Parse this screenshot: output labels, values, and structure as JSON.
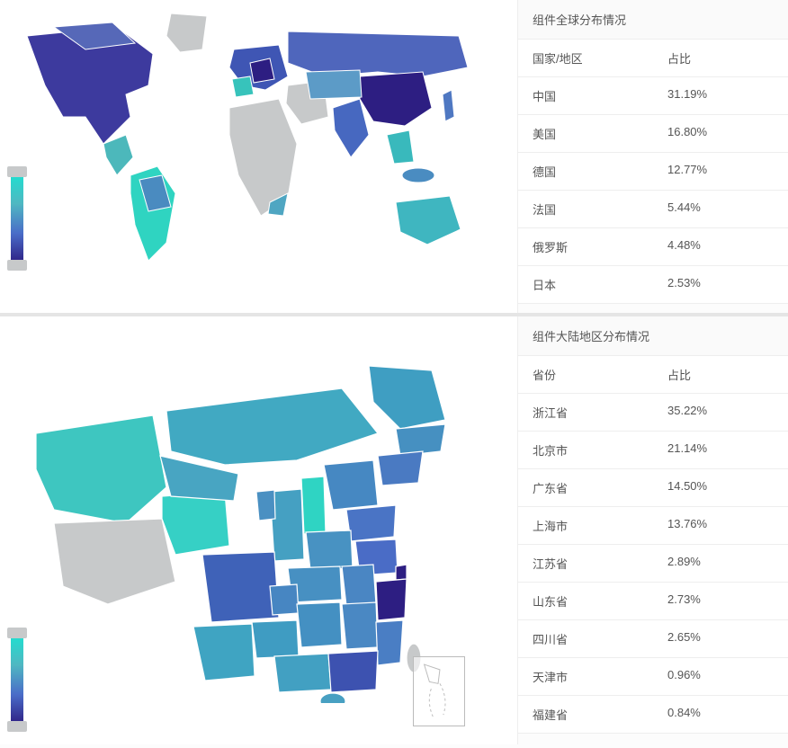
{
  "global": {
    "title": "组件全球分布情况",
    "col1": "国家/地区",
    "col2": "占比",
    "rows": [
      {
        "name": "中国",
        "pct": "31.19%"
      },
      {
        "name": "美国",
        "pct": "16.80%"
      },
      {
        "name": "德国",
        "pct": "12.77%"
      },
      {
        "name": "法国",
        "pct": "5.44%"
      },
      {
        "name": "俄罗斯",
        "pct": "4.48%"
      },
      {
        "name": "日本",
        "pct": "2.53%"
      }
    ]
  },
  "chinaMap": {
    "title": "组件大陆地区分布情况",
    "col1": "省份",
    "col2": "占比",
    "rows": [
      {
        "name": "浙江省",
        "pct": "35.22%"
      },
      {
        "name": "北京市",
        "pct": "21.14%"
      },
      {
        "name": "广东省",
        "pct": "14.50%"
      },
      {
        "name": "上海市",
        "pct": "13.76%"
      },
      {
        "name": "江苏省",
        "pct": "2.89%"
      },
      {
        "name": "山东省",
        "pct": "2.73%"
      },
      {
        "name": "四川省",
        "pct": "2.65%"
      },
      {
        "name": "天津市",
        "pct": "0.96%"
      },
      {
        "name": "福建省",
        "pct": "0.84%"
      }
    ]
  },
  "chart_data": [
    {
      "type": "choropleth-world",
      "title": "组件全球分布情况",
      "value_label": "占比",
      "unit": "%",
      "data": [
        {
          "region": "中国",
          "value": 31.19
        },
        {
          "region": "美国",
          "value": 16.8
        },
        {
          "region": "德国",
          "value": 12.77
        },
        {
          "region": "法国",
          "value": 5.44
        },
        {
          "region": "俄罗斯",
          "value": 4.48
        },
        {
          "region": "日本",
          "value": 2.53
        }
      ],
      "legend_gradient": [
        "#1ee0d0",
        "#2d1e82"
      ]
    },
    {
      "type": "choropleth-china",
      "title": "组件大陆地区分布情况",
      "value_label": "占比",
      "unit": "%",
      "data": [
        {
          "region": "浙江省",
          "value": 35.22
        },
        {
          "region": "北京市",
          "value": 21.14
        },
        {
          "region": "广东省",
          "value": 14.5
        },
        {
          "region": "上海市",
          "value": 13.76
        },
        {
          "region": "江苏省",
          "value": 2.89
        },
        {
          "region": "山东省",
          "value": 2.73
        },
        {
          "region": "四川省",
          "value": 2.65
        },
        {
          "region": "天津市",
          "value": 0.96
        },
        {
          "region": "福建省",
          "value": 0.84
        }
      ],
      "legend_gradient": [
        "#1ee0d0",
        "#2d1e82"
      ]
    }
  ]
}
